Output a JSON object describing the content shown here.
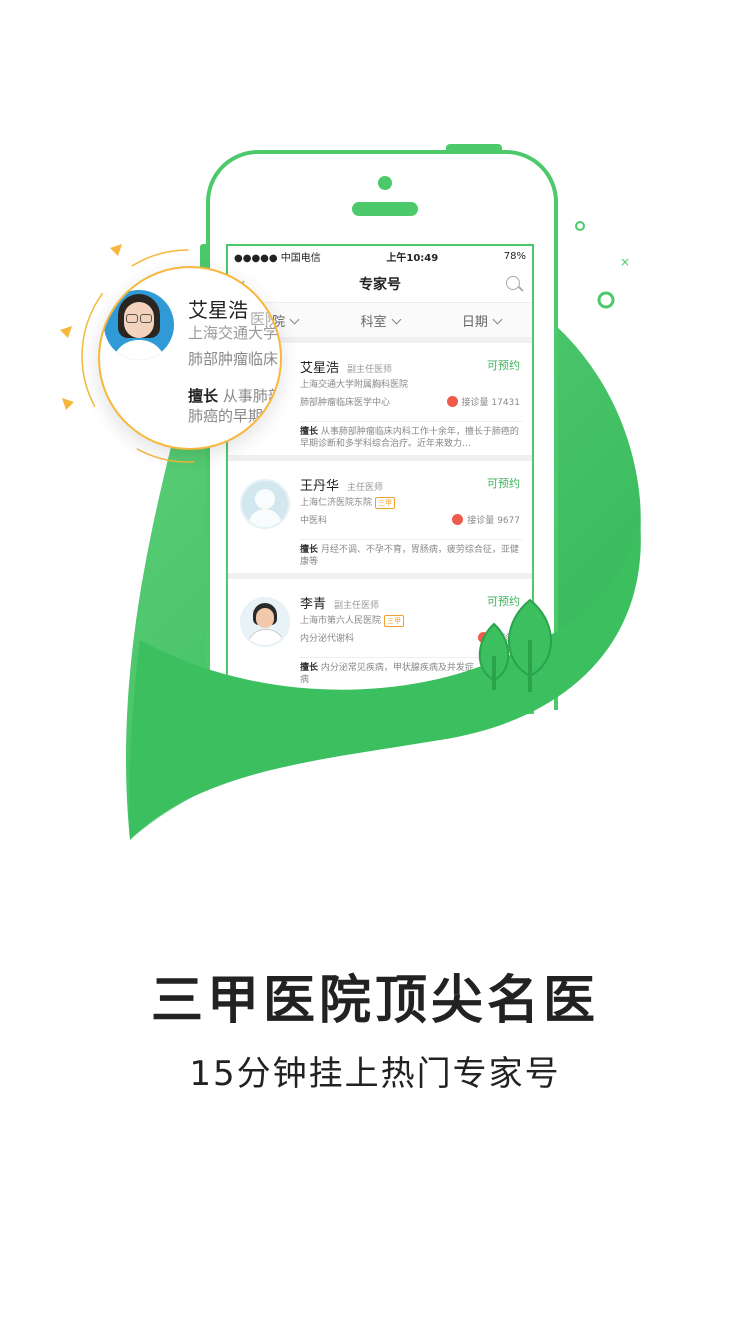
{
  "phone": {
    "statusbar": {
      "carrier": "●●●●● 中国电信",
      "time": "上午10:49",
      "battery": "78%"
    },
    "navbar": {
      "back_icon": "chevron-left-icon",
      "title": "专家号",
      "search_icon": "search-icon"
    },
    "filters": [
      "医院",
      "科室",
      "日期"
    ]
  },
  "doctors": [
    {
      "name": "艾星浩",
      "title": "副主任医师",
      "status": "可预约",
      "hospital": "上海交通大学附属胸科医院",
      "badge": "",
      "department": "肺部肿瘤临床医学中心",
      "consult": "接诊量 17431",
      "skill_label": "擅长",
      "skill": "从事肺部肿瘤临床内科工作十余年，擅长于肺癌的早期诊断和多学科综合治疗。近年来致力…"
    },
    {
      "name": "王丹华",
      "title": "主任医师",
      "status": "可预约",
      "hospital": "上海仁济医院东院",
      "badge": "三甲",
      "department": "中医科",
      "consult": "接诊量 9677",
      "skill_label": "擅长",
      "skill": "月经不调、不孕不育，胃肠病，疲劳综合征，亚健康等"
    },
    {
      "name": "李青",
      "title": "副主任医师",
      "status": "可预约",
      "hospital": "上海市第六人民医院",
      "badge": "三甲",
      "department": "内分泌代谢科",
      "consult": "接诊量",
      "skill_label": "擅长",
      "skill": "内分泌常见疾病，甲状腺疾病及并发症，甲状腺疾病"
    }
  ],
  "magnifier": {
    "name": "艾星浩",
    "hospital": "上海交通大学",
    "department": "肺部肿瘤临床",
    "skill_label": "擅长",
    "skill_line1": "从事肺部",
    "skill_line2": "肺癌的早期",
    "filter": "医院"
  },
  "headline": "三甲医院顶尖名医",
  "subline": "15分钟挂上热门专家号",
  "colors": {
    "accent": "#3cb55a",
    "leaf": "#4cc96a",
    "ring": "#f6b73c"
  }
}
